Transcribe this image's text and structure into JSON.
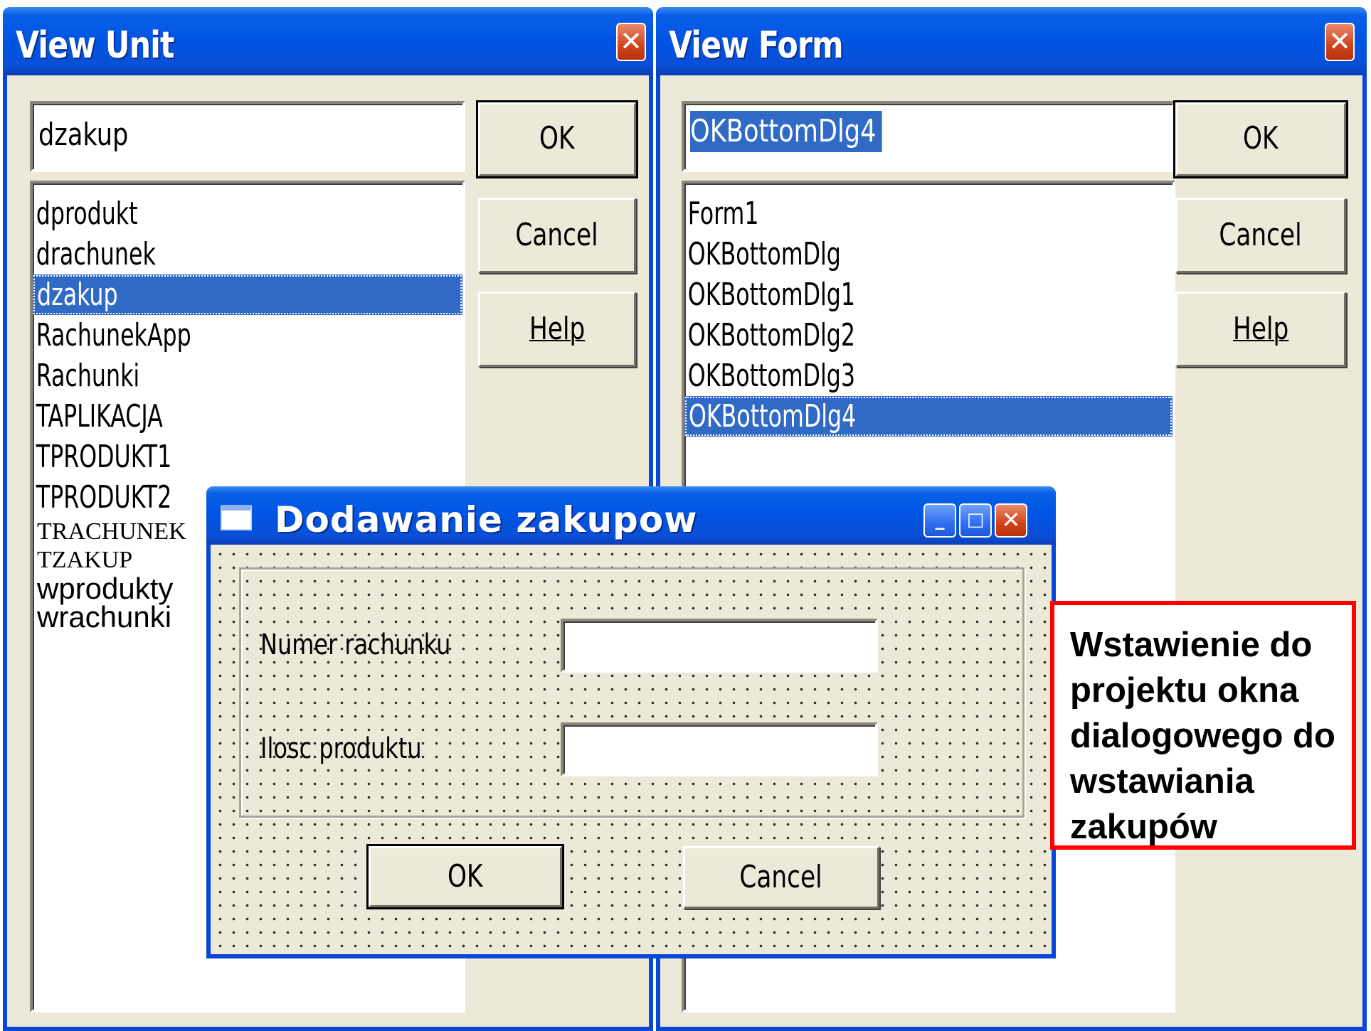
{
  "view_unit": {
    "title": "View Unit",
    "close_glyph": "✕",
    "input_value": "dzakup",
    "items": [
      "dprodukt",
      "drachunek",
      "dzakup",
      "RachunekApp",
      "Rachunki",
      "TAPLIKACJA",
      "TPRODUKT1",
      "TPRODUKT2",
      "TRACHUNEK",
      "TZAKUP",
      "wprodukty",
      "wrachunki"
    ],
    "selected_item": "dzakup",
    "ok_label": "OK",
    "cancel_label": "Cancel",
    "help_label": "Help"
  },
  "view_form": {
    "title": "View Form",
    "close_glyph": "✕",
    "input_value": "OKBottomDlg4",
    "items": [
      "Form1",
      "OKBottomDlg",
      "OKBottomDlg1",
      "OKBottomDlg2",
      "OKBottomDlg3",
      "OKBottomDlg4"
    ],
    "selected_item": "OKBottomDlg4",
    "ok_label": "OK",
    "cancel_label": "Cancel",
    "help_label": "Help"
  },
  "dialog": {
    "title": "Dodawanie zakupow",
    "minimize_glyph": "_",
    "maximize_glyph": "□",
    "close_glyph": "✕",
    "field1_label": "Numer rachunku",
    "field1_value": "",
    "field2_label": "Ilosc produktu",
    "field2_value": "",
    "ok_label": "OK",
    "cancel_label": "Cancel"
  },
  "callout": {
    "text": "Wstawienie do projektu okna dialogowego do wstawiania zakupów",
    "border_color": "#ff0000"
  },
  "colors": {
    "titlebar": "#0054e3",
    "selection": "#316ac5",
    "window_face": "#ece9d8"
  }
}
